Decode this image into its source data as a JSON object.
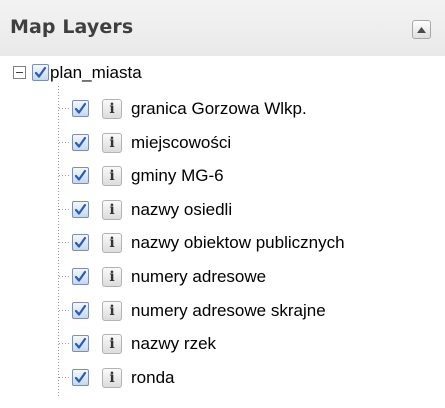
{
  "panel": {
    "title": "Map Layers",
    "collapse_icon": "collapse-up-icon"
  },
  "tree": {
    "root": {
      "label": "plan_miasta",
      "expanded": true,
      "checked": true
    },
    "layers": [
      {
        "label": "granica Gorzowa Wlkp.",
        "checked": true,
        "info_glyph": "i"
      },
      {
        "label": "miejscowości",
        "checked": true,
        "info_glyph": "i"
      },
      {
        "label": "gminy MG-6",
        "checked": true,
        "info_glyph": "i"
      },
      {
        "label": "nazwy osiedli",
        "checked": true,
        "info_glyph": "i"
      },
      {
        "label": "nazwy obiektow publicznych",
        "checked": true,
        "info_glyph": "i"
      },
      {
        "label": "numery adresowe",
        "checked": true,
        "info_glyph": "i"
      },
      {
        "label": "numery adresowe skrajne",
        "checked": true,
        "info_glyph": "i"
      },
      {
        "label": "nazwy rzek",
        "checked": true,
        "info_glyph": "i"
      },
      {
        "label": "ronda",
        "checked": true,
        "info_glyph": "i"
      }
    ]
  },
  "colors": {
    "header_bg": "#ececec",
    "title_text": "#3f3f3f",
    "checkmark": "#2a5db0"
  }
}
